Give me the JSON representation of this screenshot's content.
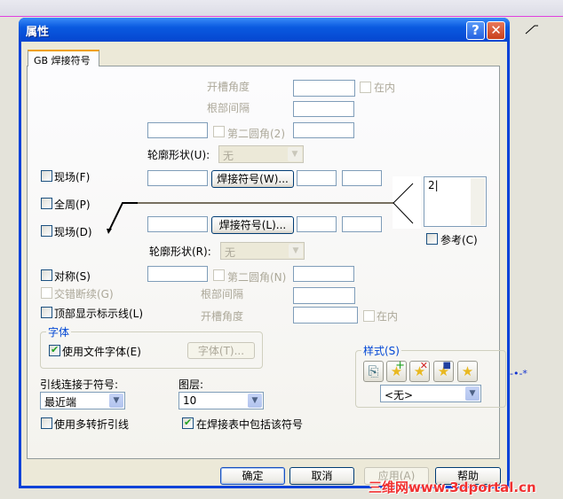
{
  "window": {
    "title": "属性",
    "help": "?",
    "close": "✕"
  },
  "tab": "GB 焊接符号",
  "upper": {
    "groove_angle": "开槽角度",
    "inside": "在内",
    "root_gap": "根部间隔",
    "second_fillet": "第二圆角(2)",
    "contour": "轮廓形状(U):",
    "contour_value": "无",
    "field": "现场(F)",
    "weld_button": "焊接符号(W)..."
  },
  "all_around": "全周(P)",
  "lower": {
    "field": "现场(D)",
    "weld_button": "焊接符号(L)...",
    "contour": "轮廓形状(R):",
    "contour_value": "无",
    "symmetric": "对称(S)",
    "second_fillet": "第二圆角(N)",
    "staggered": "交错断续(G)",
    "root_gap": "根部间隔",
    "top_line": "顶部显示标示线(L)",
    "groove_angle": "开槽角度",
    "inside": "在内"
  },
  "tail": {
    "text": "2",
    "reference": "参考(C)"
  },
  "font": {
    "legend": "字体",
    "use_doc_font": "使用文件字体(E)",
    "font_button": "字体(T)..."
  },
  "style": {
    "legend": "样式(S)",
    "value": "<无>",
    "icons": [
      "update-style-icon",
      "add-style-icon",
      "delete-style-icon",
      "save-style-icon",
      "load-style-icon"
    ]
  },
  "leader": {
    "label": "引线连接于符号:",
    "value": "最近端"
  },
  "layer": {
    "label": "图层:",
    "value": "10"
  },
  "multi_jog": "使用多转折引线",
  "include_table": "在焊接表中包括该符号",
  "buttons": {
    "ok": "确定",
    "cancel": "取消",
    "apply": "应用(A)",
    "help": "帮助"
  },
  "watermark": "三维网www.3dportal.cn"
}
